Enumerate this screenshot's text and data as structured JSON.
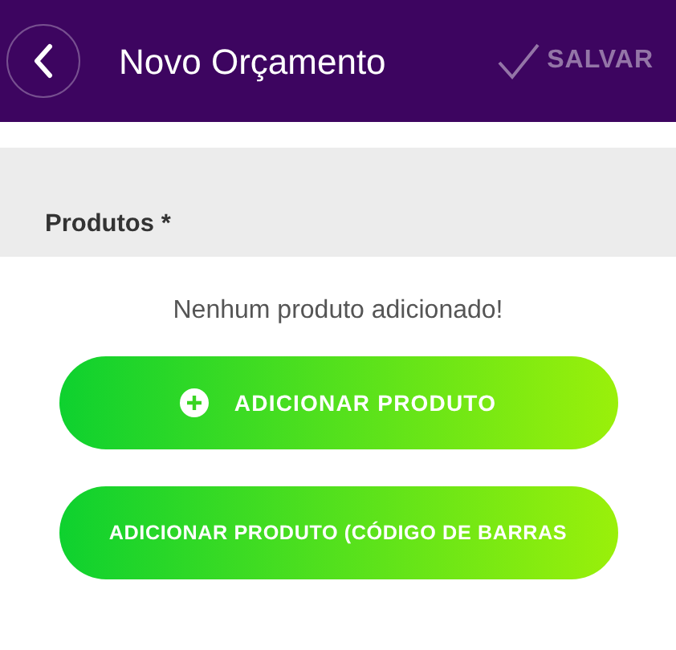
{
  "header": {
    "title": "Novo Orçamento",
    "save_button": {
      "label": "SALVAR",
      "disabled": true
    }
  },
  "section": {
    "label": "Produtos *"
  },
  "empty_message": "Nenhum produto adicionado!",
  "buttons": [
    {
      "label": "ADICIONAR PRODUTO",
      "kind": "icon"
    },
    {
      "label": "ADICIONAR PRODUTO (CÓDIGO DE BARRAS",
      "kind": "plain"
    }
  ]
}
